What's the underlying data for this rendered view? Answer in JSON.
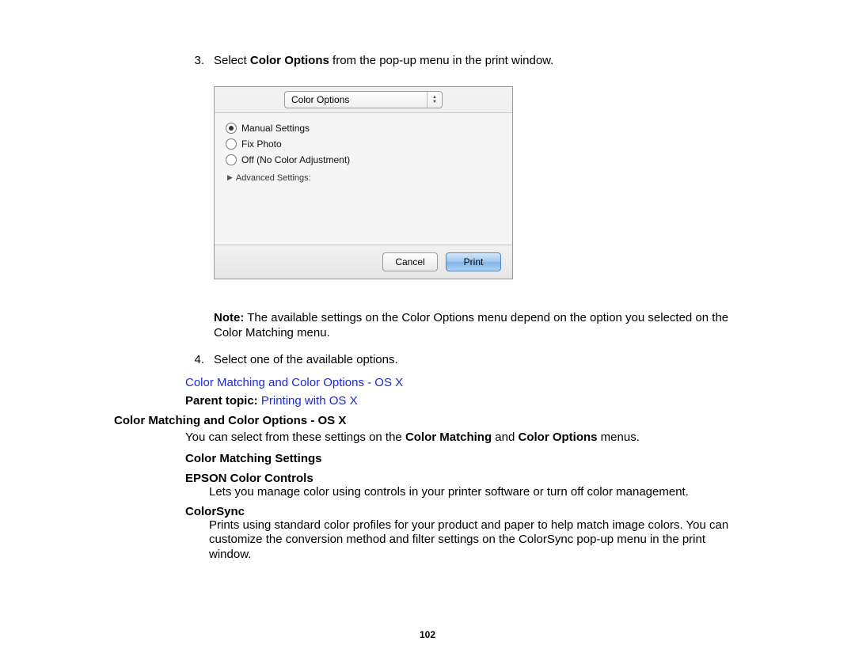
{
  "steps": {
    "s3": {
      "num": "3.",
      "pre": "Select ",
      "bold": "Color Options",
      "post": " from the pop-up menu in the print window."
    },
    "s4": {
      "num": "4.",
      "text": "Select one of the available options."
    }
  },
  "screenshot": {
    "dropdown_label": "Color Options",
    "radio1": "Manual Settings",
    "radio2": "Fix Photo",
    "radio3": "Off (No Color Adjustment)",
    "advanced": "Advanced Settings:",
    "cancel": "Cancel",
    "print": "Print"
  },
  "note": {
    "bold": "Note:",
    "text": " The available settings on the Color Options menu depend on the option you selected on the Color Matching menu."
  },
  "sublink": "Color Matching and Color Options - OS X",
  "parent": {
    "label": "Parent topic: ",
    "link": "Printing with OS X"
  },
  "section": {
    "heading": "Color Matching and Color Options - OS X",
    "intro_pre": "You can select from these settings on the ",
    "intro_b1": "Color Matching",
    "intro_mid": " and ",
    "intro_b2": "Color Options",
    "intro_post": " menus.",
    "cm_settings": "Color Matching Settings",
    "epson_t": "EPSON Color Controls",
    "epson_d": "Lets you manage color using controls in your printer software or turn off color management.",
    "cs_t": "ColorSync",
    "cs_d": "Prints using standard color profiles for your product and paper to help match image colors. You can customize the conversion method and filter settings on the ColorSync pop-up menu in the print window."
  },
  "page_number": "102"
}
